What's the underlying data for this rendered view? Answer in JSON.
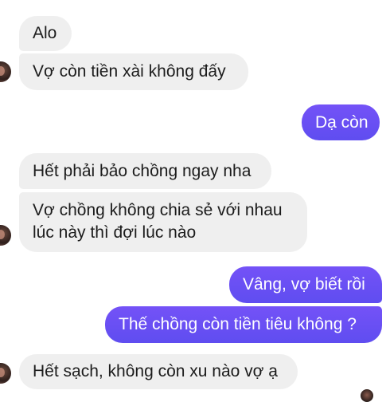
{
  "messages": [
    {
      "sender": "other",
      "text": "Alo"
    },
    {
      "sender": "other",
      "text": "Vợ còn tiền xài không đấy"
    },
    {
      "sender": "me",
      "text": "Dạ còn"
    },
    {
      "sender": "other",
      "text": "Hết phải bảo chồng ngay nha"
    },
    {
      "sender": "other",
      "text_line1": "Vợ chồng không chia sẻ với nhau",
      "text_line2": "lúc này thì đợi lúc nào"
    },
    {
      "sender": "me",
      "text": "Vâng, vợ biết rồi"
    },
    {
      "sender": "me",
      "text": "Thế chồng còn tiền tiêu không ?"
    },
    {
      "sender": "other",
      "text": "Hết sạch, không còn xu nào vợ ạ"
    }
  ],
  "colors": {
    "incoming_bubble": "#efefef",
    "outgoing_bubble": "#6b4ef6",
    "incoming_text": "#1c1c1c",
    "outgoing_text": "#ffffff"
  },
  "icons": {
    "contact_avatar": "avatar",
    "seen_receipt": "avatar"
  }
}
